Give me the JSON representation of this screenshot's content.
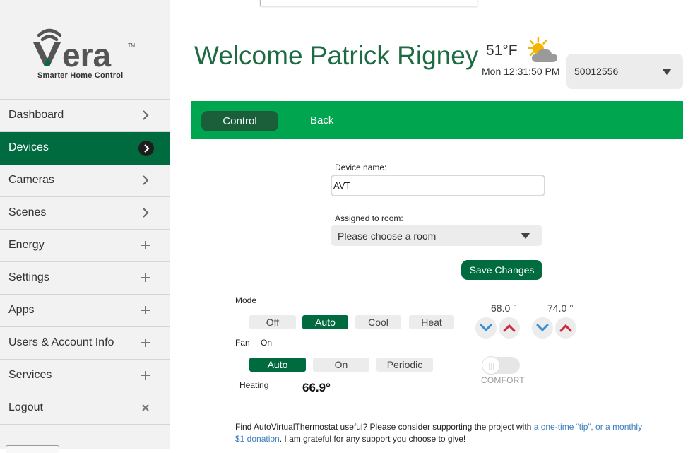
{
  "brand": {
    "tagline": "Smarter Home Control",
    "logo_color": "#555555",
    "accent": "#006b3f"
  },
  "sidebar": {
    "items": [
      {
        "label": "Dashboard",
        "icon": "chevron-right-icon"
      },
      {
        "label": "Devices",
        "icon": "chevron-right-circle-icon",
        "active": true
      },
      {
        "label": "Cameras",
        "icon": "chevron-right-icon"
      },
      {
        "label": "Scenes",
        "icon": "chevron-right-icon"
      },
      {
        "label": "Energy",
        "icon": "plus-icon"
      },
      {
        "label": "Settings",
        "icon": "plus-icon"
      },
      {
        "label": "Apps",
        "icon": "plus-icon"
      },
      {
        "label": "Users & Account Info",
        "icon": "plus-icon"
      },
      {
        "label": "Services",
        "icon": "plus-icon"
      },
      {
        "label": "Logout",
        "icon": "close-icon"
      }
    ]
  },
  "header": {
    "welcome": "Welcome Patrick Rigney",
    "temperature": "51°F",
    "weather_icon": "partly-cloudy-icon",
    "clock": "Mon 12:31:50 PM",
    "unit_select": "50012556"
  },
  "tabs": {
    "control": "Control",
    "back": "Back"
  },
  "form": {
    "device_name_label": "Device name:",
    "device_name_value": "AVT",
    "room_label": "Assigned to room:",
    "room_placeholder": "Please choose a room",
    "save_label": "Save Changes"
  },
  "thermostat": {
    "mode_label": "Mode",
    "modes": [
      "Off",
      "Auto",
      "Cool",
      "Heat"
    ],
    "mode_selected": "Auto",
    "fan_label": "Fan",
    "fan_status": "On",
    "fan_modes": [
      "Auto",
      "On",
      "Periodic"
    ],
    "fan_selected": "Auto",
    "heat_setpoint": "68.0 °",
    "cool_setpoint": "74.0 °",
    "comfort_label": "COMFORT",
    "state_label": "Heating",
    "current_temp": "66.9°",
    "up_color": "#d0283a",
    "down_color": "#3a8fd0"
  },
  "footer": {
    "part1": "Find AutoVirtualThermostat useful?",
    "part2": " Please consider supporting the project with ",
    "link1": "a one-time “tip”, or a monthly $1 donation",
    "part3": ". I am grateful for any support you choose to give!"
  }
}
